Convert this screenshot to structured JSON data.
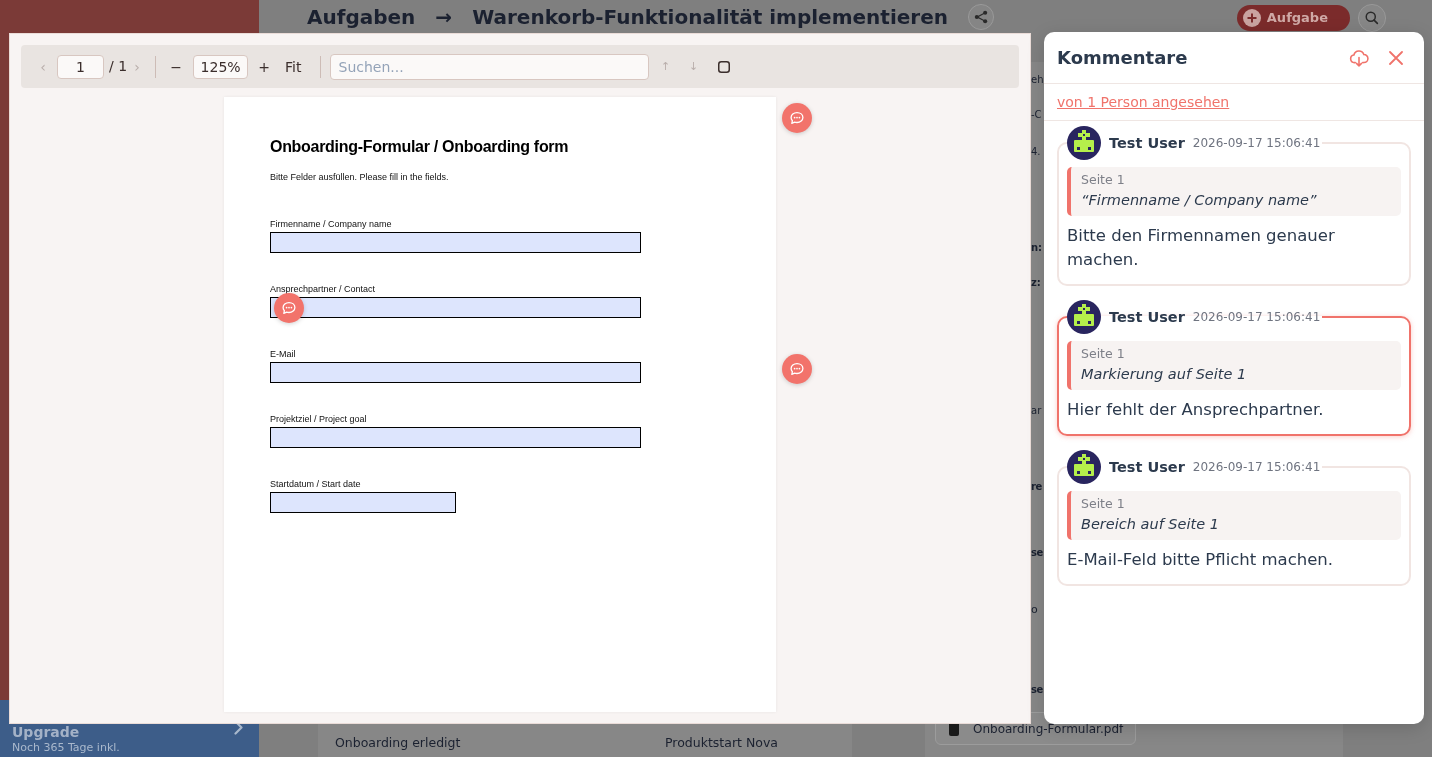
{
  "app_background": {
    "sidebar": {
      "upgrade_title": "Upgrade",
      "upgrade_note": "Noch 365 Tage inkl."
    },
    "header": {
      "section": "Aufgaben",
      "separator": "→",
      "task_title": "Warenkorb-Funktionalität implementieren",
      "add_button": "Aufgabe"
    },
    "milestone_row": [
      "Onboarding erledigt",
      "Produktstart Nova"
    ],
    "detail_fragments": [
      {
        "text": "eh",
        "kind": "label"
      },
      {
        "text": "-C",
        "kind": "label"
      },
      {
        "text": "4.",
        "kind": "label"
      },
      {
        "text": "n:",
        "kind": "value"
      },
      {
        "text": "z:",
        "kind": "value"
      },
      {
        "text": "ar",
        "kind": "label"
      },
      {
        "text": "re",
        "kind": "heading"
      },
      {
        "text": "se",
        "kind": "heading"
      },
      {
        "text": "o",
        "kind": "large"
      },
      {
        "text": "se",
        "kind": "heading"
      }
    ],
    "attachment": {
      "file_name": "Onboarding-Formular.pdf"
    }
  },
  "pdf_viewer": {
    "toolbar": {
      "prev_page": {
        "label": "‹",
        "disabled": true
      },
      "page_input": {
        "value": "1"
      },
      "page_total": "/ 1",
      "next_page": {
        "label": "›",
        "disabled": true
      },
      "zoom_out": {
        "label": "−",
        "disabled": false
      },
      "zoom_value": {
        "value": "125%"
      },
      "zoom_in": {
        "label": "+",
        "disabled": false
      },
      "fit": {
        "label": "Fit",
        "disabled": false
      },
      "search": {
        "placeholder": "Suchen..."
      },
      "match_up": {
        "label": "↑",
        "disabled": true
      },
      "match_down": {
        "label": "↓",
        "disabled": true
      },
      "area_tool": {
        "disabled": false
      }
    },
    "page": {
      "title": "Onboarding-Formular / Onboarding form",
      "intro": "Bitte Felder ausfüllen. Please fill in the fields.",
      "margin_comment": true,
      "fields": [
        {
          "label": "Firmenname / Company name",
          "kind": "wide",
          "margin_comment": false,
          "inline_comment": false
        },
        {
          "label": "Ansprechpartner / Contact",
          "kind": "wide",
          "margin_comment": false,
          "inline_comment": true
        },
        {
          "label": "E-Mail",
          "kind": "wide",
          "margin_comment": true,
          "inline_comment": false
        },
        {
          "label": "Projektziel / Project goal",
          "kind": "wide",
          "margin_comment": false,
          "inline_comment": false
        },
        {
          "label": "Startdatum / Start date",
          "kind": "narrow",
          "margin_comment": false,
          "inline_comment": false
        }
      ]
    }
  },
  "comments_panel": {
    "title": "Kommentare",
    "viewed_by": "von 1 Person angesehen",
    "comments": [
      {
        "author": "Test User",
        "time": "2026-09-17 15:06:41",
        "page": "Seite 1",
        "quote": "“Firmenname / Company name”",
        "body": "Bitte den Firmennamen genauer machen.",
        "selected": false
      },
      {
        "author": "Test User",
        "time": "2026-09-17 15:06:41",
        "page": "Seite 1",
        "quote": "Markierung auf Seite 1",
        "body": "Hier fehlt der Ansprechpartner.",
        "selected": true
      },
      {
        "author": "Test User",
        "time": "2026-09-17 15:06:41",
        "page": "Seite 1",
        "quote": "Bereich auf Seite 1",
        "body": "E-Mail-Feld bitte Pflicht machen.",
        "selected": false
      }
    ]
  }
}
